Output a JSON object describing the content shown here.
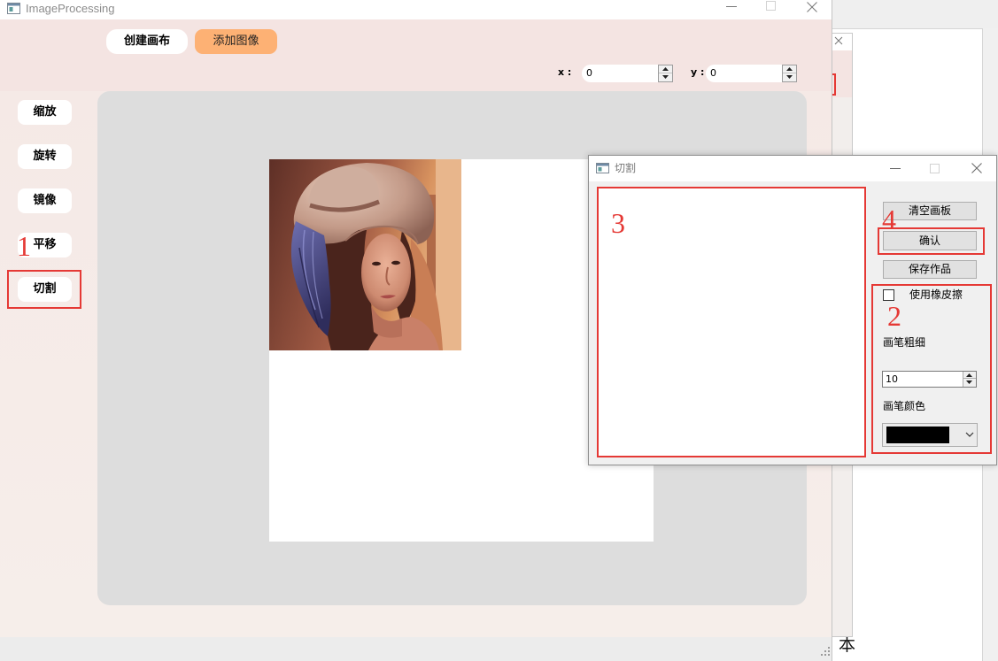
{
  "main_window": {
    "title": "ImageProcessing",
    "toolbar": {
      "create_canvas": "创建画布",
      "add_image": "添加图像",
      "x_label": "x :",
      "x_value": "0",
      "y_label": "y :",
      "y_value": "0"
    },
    "sidebar": {
      "items": [
        {
          "label": "缩放"
        },
        {
          "label": "旋转"
        },
        {
          "label": "镜像"
        },
        {
          "label": "平移"
        },
        {
          "label": "切割"
        }
      ]
    }
  },
  "crop_dialog": {
    "title": "切割",
    "clear_button": "清空画板",
    "confirm_button": "确认",
    "save_button": "保存作品",
    "eraser": {
      "label": "使用橡皮擦",
      "checked": false
    },
    "brush_size": {
      "label": "画笔粗细",
      "value": "10"
    },
    "brush_color": {
      "label": "画笔颜色",
      "value": "#000000"
    }
  },
  "annotations": [
    "1",
    "2",
    "3",
    "4"
  ],
  "background_window": {
    "text": "本"
  },
  "colors": {
    "toolbar_bg": "#f4e4e2",
    "content_bg": "#f6ece8",
    "canvas_area": "#dddddd",
    "add_image_button": "#fdb174",
    "annotation_red": "#e53935"
  },
  "icons": {
    "app": "app-window-icon",
    "minimize": "minimize-icon",
    "maximize": "maximize-icon",
    "close": "close-icon",
    "spin_up": "spin-up-icon",
    "spin_down": "spin-down-icon",
    "dropdown": "chevron-down-icon",
    "size_grip": "size-grip-icon"
  }
}
